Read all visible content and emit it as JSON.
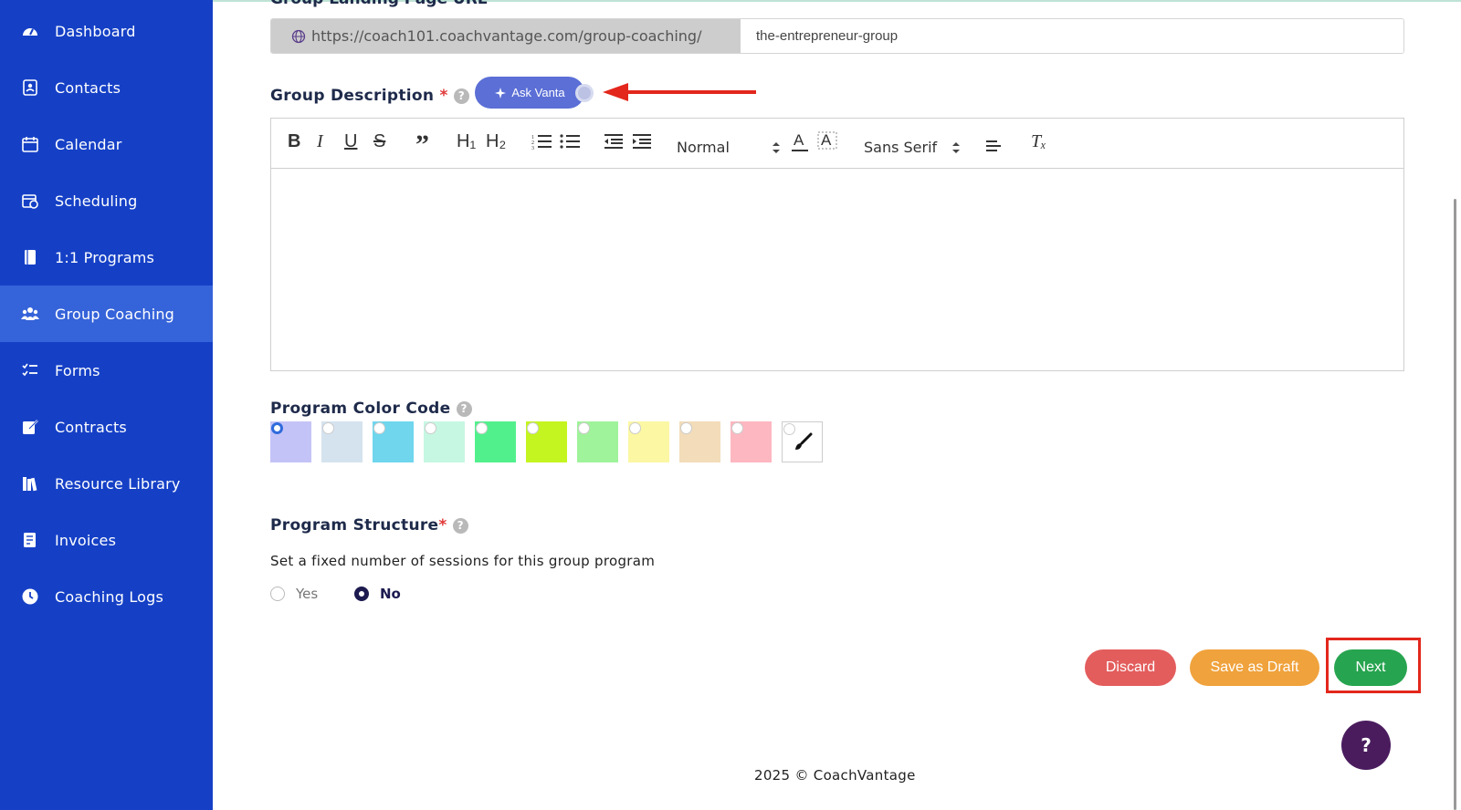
{
  "sidebar": {
    "items": [
      {
        "label": "Dashboard",
        "icon": "dashboard-icon"
      },
      {
        "label": "Contacts",
        "icon": "contacts-icon"
      },
      {
        "label": "Calendar",
        "icon": "calendar-icon"
      },
      {
        "label": "Scheduling",
        "icon": "scheduling-icon"
      },
      {
        "label": "1:1 Programs",
        "icon": "book-icon"
      },
      {
        "label": "Group Coaching",
        "icon": "users-icon",
        "active": true
      },
      {
        "label": "Forms",
        "icon": "checklist-icon"
      },
      {
        "label": "Contracts",
        "icon": "sign-icon"
      },
      {
        "label": "Resource Library",
        "icon": "library-icon"
      },
      {
        "label": "Invoices",
        "icon": "invoice-icon"
      },
      {
        "label": "Coaching Logs",
        "icon": "clock-icon"
      }
    ],
    "bg_color": "#1540c6",
    "active_color": "#3563d9"
  },
  "landing_url": {
    "label": "Group Landing Page URL",
    "prefix": "https://coach101.coachvantage.com/group-coaching/",
    "value": "the-entrepreneur-group"
  },
  "description": {
    "label": "Group Description",
    "required_mark": "*",
    "help": "?",
    "ask_vanta": "Ask Vanta",
    "toolbar": {
      "bold": "B",
      "italic": "I",
      "underline": "U",
      "strike": "S",
      "quote": "”",
      "h1": "H₁",
      "h2": "H₂",
      "size_select": "Normal",
      "font_select": "Sans Serif",
      "clear_format": "Tₓ"
    }
  },
  "color_code": {
    "label": "Program Color Code",
    "help": "?",
    "swatches": [
      "#c4c3f7",
      "#d5e3ef",
      "#6fd6ee",
      "#c6f7e2",
      "#52f08d",
      "#c4f520",
      "#9ff39a",
      "#fbf7a3",
      "#f2dcb9",
      "#fdb7c0"
    ],
    "selected_index": 0
  },
  "structure": {
    "label": "Program Structure",
    "required_mark": "*",
    "help": "?",
    "question": "Set a fixed number of sessions for this group program",
    "options": [
      {
        "label": "Yes",
        "selected": false
      },
      {
        "label": "No",
        "selected": true
      }
    ]
  },
  "actions": {
    "discard": "Discard",
    "save_draft": "Save as Draft",
    "next": "Next"
  },
  "help_fab": "?",
  "footer": "2025 © CoachVantage"
}
